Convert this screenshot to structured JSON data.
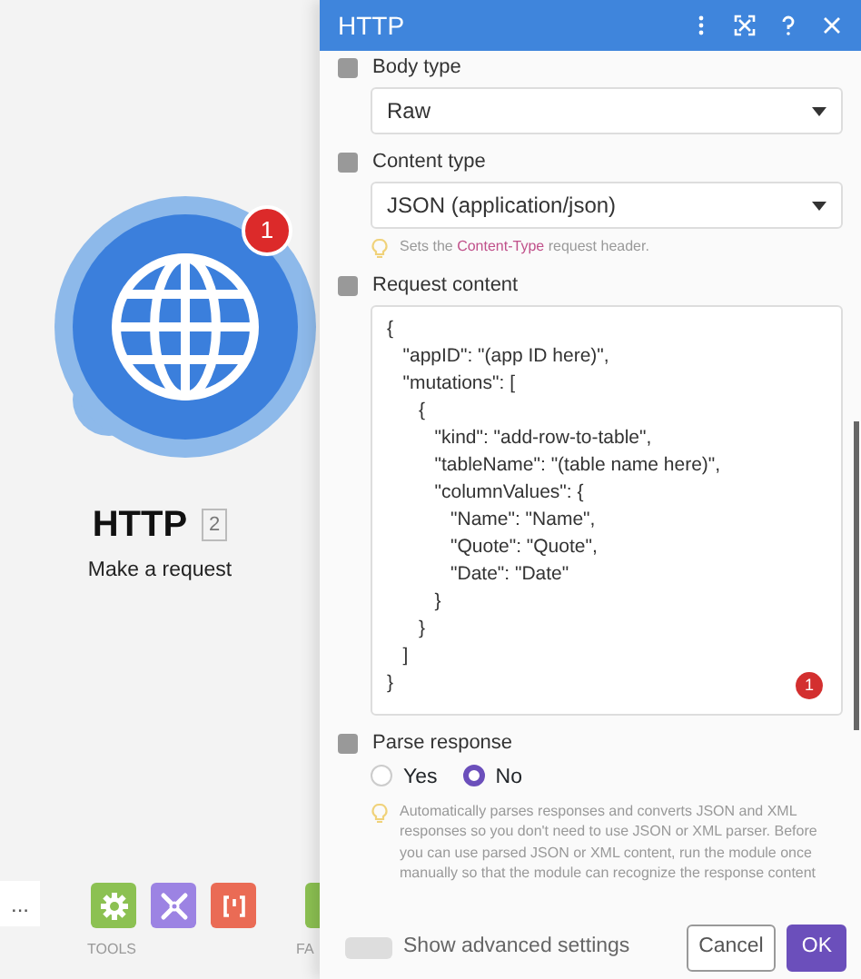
{
  "canvas": {
    "module": {
      "title": "HTTP",
      "count": "2",
      "subtitle": "Make a request",
      "badge": "1"
    },
    "toolbar": {
      "more": "...",
      "tools": [
        {
          "kind": "gear",
          "color": "#8cc152",
          "label": "TOOLS"
        },
        {
          "kind": "wrench",
          "color": "#9c83e3"
        },
        {
          "kind": "brackets",
          "color": "#ea6b55"
        },
        {
          "kind": "partial",
          "color": "#8cc152",
          "label": "FA"
        }
      ]
    }
  },
  "panel": {
    "title": "HTTP",
    "fields": [
      {
        "kind": "select",
        "label": "Body type",
        "checked": true,
        "value": "Raw"
      },
      {
        "kind": "select",
        "label": "Content type",
        "checked": true,
        "value": "JSON (application/json)",
        "hint": "Sets the **Content-Type** request header."
      },
      {
        "kind": "code",
        "label": "Request content",
        "checked": true,
        "lines": [
          "{",
          "   \"appID\": \"(app ID here)\",",
          "   \"mutations\": [",
          "      {",
          "         \"kind\": \"add-row-to-table\",",
          "         \"tableName\": \"(table name here)\",",
          "         \"columnValues\": {",
          "            \"Name\": \"Name\",",
          "            \"Quote\": \"Quote\",",
          "            \"Date\": \"Date\"",
          "         }",
          "      }",
          "   ]",
          "}"
        ],
        "badge": "1"
      },
      {
        "kind": "radio",
        "label": "Parse response",
        "checked": true,
        "options": [
          {
            "label": "Yes",
            "selected": false
          },
          {
            "label": "No",
            "selected": true
          }
        ],
        "hint": "Automatically parses responses and converts JSON and XML responses so you don't need to use JSON or XML parser. Before you can use parsed JSON or XML content, run the module once manually so that the module can recognize the response content"
      }
    ],
    "advanced": {
      "label": "Show advanced settings",
      "on": false
    },
    "buttons": [
      {
        "label": "Cancel",
        "kind": "secondary"
      },
      {
        "label": "OK",
        "kind": "primary"
      }
    ]
  }
}
